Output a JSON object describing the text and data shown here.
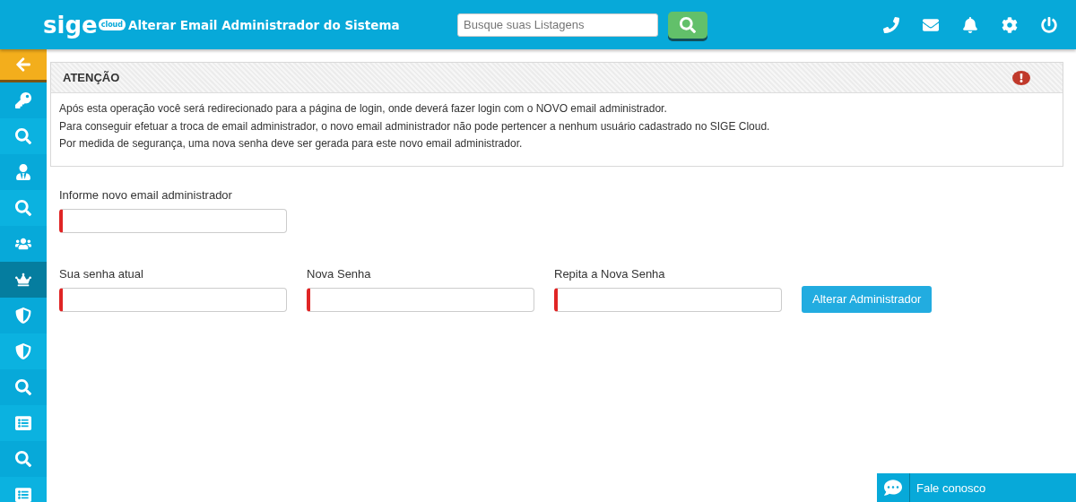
{
  "header": {
    "logo": "sige",
    "logo_badge": "cloud",
    "title": "Alterar Email Administrador do Sistema",
    "search": {
      "placeholder": "Busque suas Listagens"
    },
    "actions": [
      {
        "kind": "phone"
      },
      {
        "kind": "mail"
      },
      {
        "kind": "bell"
      },
      {
        "kind": "gear"
      },
      {
        "kind": "power"
      }
    ]
  },
  "sidebar": {
    "items": [
      {
        "kind": "back",
        "selected": false
      },
      {
        "kind": "key",
        "selected": false
      },
      {
        "kind": "search",
        "selected": false
      },
      {
        "kind": "person",
        "selected": false
      },
      {
        "kind": "search",
        "selected": false
      },
      {
        "kind": "group",
        "selected": false
      },
      {
        "kind": "crown",
        "selected": true
      },
      {
        "kind": "shield",
        "selected": false
      },
      {
        "kind": "shield",
        "selected": false
      },
      {
        "kind": "search",
        "selected": false
      },
      {
        "kind": "list",
        "selected": false
      },
      {
        "kind": "search",
        "selected": false
      },
      {
        "kind": "list",
        "selected": false
      }
    ]
  },
  "notice": {
    "title": "ATENÇÃO",
    "lines": [
      "Após esta operação você será redirecionado para a página de login, onde deverá fazer login com o NOVO email administrador.",
      "Para conseguir efetuar a troca de email administrador, o novo email administrador não pode pertencer a nenhum usuário cadastrado no SIGE Cloud.",
      "Por medida de segurança, uma nova senha deve ser gerada para este novo email administrador."
    ]
  },
  "form": {
    "email_field": {
      "label": "Informe novo email administrador",
      "required": true
    },
    "password_fields": [
      {
        "label": "Sua senha atual",
        "required": true
      },
      {
        "label": "Nova Senha",
        "required": true
      },
      {
        "label": "Repita a Nova Senha",
        "required": true
      }
    ],
    "submit": "Alterar Administrador"
  },
  "chat": {
    "label": "Fale conosco"
  }
}
